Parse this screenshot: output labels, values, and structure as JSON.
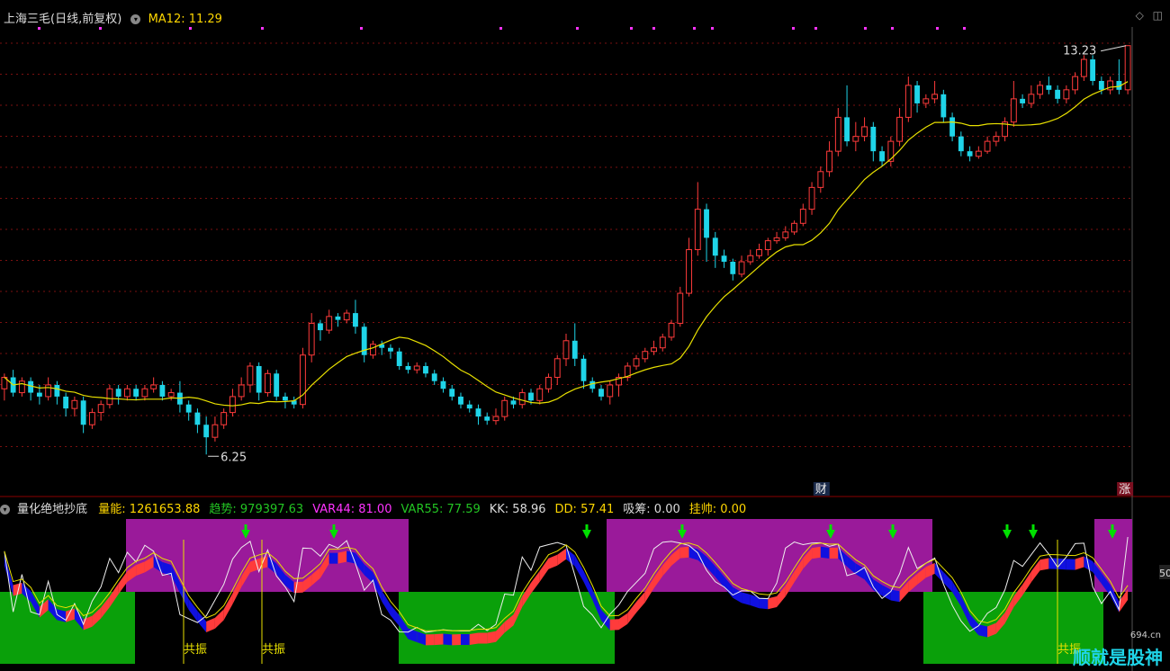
{
  "main_panel": {
    "title": "上海三毛(日线,前复权)",
    "ma_label": "MA12:",
    "ma_value": "11.29",
    "high_label": "13.23",
    "low_label": "6.25",
    "marker_cai": "财",
    "marker_zhang": "涨"
  },
  "indicator_panel": {
    "title": "量化绝地抄底",
    "items": [
      {
        "label": "量能:",
        "value": "1261653.88",
        "color": "#ffd700"
      },
      {
        "label": "趋势:",
        "value": "979397.63",
        "color": "#23c523"
      },
      {
        "label": "VAR44:",
        "value": "81.00",
        "color": "#ff33ff"
      },
      {
        "label": "VAR55:",
        "value": "77.59",
        "color": "#23c523"
      },
      {
        "label": "KK:",
        "value": "58.96",
        "color": "#dddddd"
      },
      {
        "label": "DD:",
        "value": "57.41",
        "color": "#ffd700"
      },
      {
        "label": "吸筹:",
        "value": "0.00",
        "color": "#dddddd"
      },
      {
        "label": "挂帅:",
        "value": "0.00",
        "color": "#ffd700"
      }
    ],
    "resonance_label": "共振",
    "right_edge_value": "50"
  },
  "watermark": {
    "text": "顺就是股神",
    "url": "694.cn"
  },
  "chart_data": {
    "type": "candlestick",
    "series_name": "上海三毛(日线,前复权)",
    "y_scale": "log",
    "candles": [
      [
        7.05,
        7.2,
        7.25,
        6.9
      ],
      [
        7.2,
        7.0,
        7.3,
        6.95
      ],
      [
        7.0,
        7.15,
        7.2,
        6.95
      ],
      [
        7.15,
        7.0,
        7.2,
        6.9
      ],
      [
        7.0,
        6.95,
        7.1,
        6.85
      ],
      [
        6.95,
        7.1,
        7.2,
        6.9
      ],
      [
        7.1,
        6.95,
        7.15,
        6.85
      ],
      [
        6.95,
        6.8,
        7.0,
        6.7
      ],
      [
        6.8,
        6.9,
        6.95,
        6.7
      ],
      [
        6.9,
        6.6,
        6.95,
        6.5
      ],
      [
        6.6,
        6.75,
        6.8,
        6.55
      ],
      [
        6.75,
        6.85,
        6.9,
        6.65
      ],
      [
        6.85,
        7.05,
        7.1,
        6.8
      ],
      [
        7.05,
        6.95,
        7.1,
        6.85
      ],
      [
        6.95,
        7.05,
        7.1,
        6.9
      ],
      [
        7.05,
        6.95,
        7.1,
        6.9
      ],
      [
        6.95,
        7.05,
        7.1,
        6.9
      ],
      [
        7.05,
        7.1,
        7.2,
        7.0
      ],
      [
        7.1,
        6.95,
        7.15,
        6.9
      ],
      [
        6.95,
        7.0,
        7.05,
        6.9
      ],
      [
        7.0,
        6.85,
        7.15,
        6.75
      ],
      [
        6.85,
        6.75,
        6.9,
        6.65
      ],
      [
        6.75,
        6.6,
        6.8,
        6.5
      ],
      [
        6.6,
        6.45,
        6.7,
        6.25
      ],
      [
        6.45,
        6.6,
        6.7,
        6.4
      ],
      [
        6.6,
        6.75,
        6.8,
        6.55
      ],
      [
        6.75,
        6.95,
        7.05,
        6.7
      ],
      [
        6.95,
        7.1,
        7.2,
        6.9
      ],
      [
        7.1,
        7.35,
        7.4,
        7.0
      ],
      [
        7.35,
        7.0,
        7.4,
        6.9
      ],
      [
        7.0,
        7.25,
        7.3,
        6.95
      ],
      [
        7.25,
        6.95,
        7.3,
        6.9
      ],
      [
        6.95,
        6.9,
        7.0,
        6.8
      ],
      [
        6.9,
        6.85,
        6.95,
        6.8
      ],
      [
        6.85,
        7.5,
        7.6,
        6.8
      ],
      [
        7.5,
        7.95,
        8.1,
        7.4
      ],
      [
        7.95,
        7.85,
        8.0,
        7.7
      ],
      [
        7.85,
        8.05,
        8.15,
        7.8
      ],
      [
        8.05,
        8.0,
        8.1,
        7.9
      ],
      [
        8.0,
        8.1,
        8.15,
        7.95
      ],
      [
        8.1,
        7.9,
        8.3,
        7.8
      ],
      [
        7.9,
        7.5,
        7.95,
        7.4
      ],
      [
        7.5,
        7.65,
        7.7,
        7.45
      ],
      [
        7.65,
        7.6,
        7.7,
        7.5
      ],
      [
        7.6,
        7.55,
        7.65,
        7.45
      ],
      [
        7.55,
        7.35,
        7.6,
        7.3
      ],
      [
        7.35,
        7.3,
        7.4,
        7.25
      ],
      [
        7.3,
        7.35,
        7.4,
        7.25
      ],
      [
        7.35,
        7.25,
        7.4,
        7.2
      ],
      [
        7.25,
        7.15,
        7.3,
        7.1
      ],
      [
        7.15,
        7.05,
        7.2,
        7.0
      ],
      [
        7.05,
        6.95,
        7.1,
        6.9
      ],
      [
        6.95,
        6.85,
        7.0,
        6.8
      ],
      [
        6.85,
        6.8,
        6.9,
        6.75
      ],
      [
        6.8,
        6.7,
        6.85,
        6.6
      ],
      [
        6.7,
        6.65,
        6.75,
        6.6
      ],
      [
        6.65,
        6.7,
        6.8,
        6.6
      ],
      [
        6.7,
        6.9,
        6.95,
        6.65
      ],
      [
        6.9,
        6.85,
        6.95,
        6.8
      ],
      [
        6.85,
        7.0,
        7.05,
        6.8
      ],
      [
        7.0,
        6.9,
        7.05,
        6.85
      ],
      [
        6.9,
        7.05,
        7.1,
        6.85
      ],
      [
        7.05,
        7.2,
        7.25,
        7.0
      ],
      [
        7.2,
        7.45,
        7.5,
        7.1
      ],
      [
        7.45,
        7.7,
        7.8,
        7.35
      ],
      [
        7.7,
        7.45,
        7.95,
        7.35
      ],
      [
        7.45,
        7.15,
        7.5,
        7.05
      ],
      [
        7.15,
        7.05,
        7.2,
        7.0
      ],
      [
        7.05,
        6.95,
        7.1,
        6.9
      ],
      [
        6.95,
        7.1,
        7.15,
        6.85
      ],
      [
        7.1,
        7.2,
        7.25,
        6.95
      ],
      [
        7.2,
        7.35,
        7.4,
        7.15
      ],
      [
        7.35,
        7.45,
        7.5,
        7.3
      ],
      [
        7.45,
        7.55,
        7.6,
        7.4
      ],
      [
        7.55,
        7.6,
        7.7,
        7.5
      ],
      [
        7.6,
        7.75,
        7.8,
        7.55
      ],
      [
        7.75,
        7.95,
        8.0,
        7.7
      ],
      [
        7.95,
        8.4,
        8.5,
        7.9
      ],
      [
        8.4,
        9.1,
        9.3,
        8.35
      ],
      [
        9.1,
        9.8,
        10.3,
        9.0
      ],
      [
        9.8,
        9.3,
        9.9,
        8.9
      ],
      [
        9.3,
        9.0,
        9.4,
        8.8
      ],
      [
        9.0,
        8.9,
        9.1,
        8.8
      ],
      [
        8.9,
        8.7,
        8.95,
        8.6
      ],
      [
        8.7,
        8.9,
        9.0,
        8.65
      ],
      [
        8.9,
        9.0,
        9.1,
        8.85
      ],
      [
        9.0,
        9.1,
        9.2,
        8.95
      ],
      [
        9.1,
        9.25,
        9.3,
        9.0
      ],
      [
        9.25,
        9.3,
        9.4,
        9.2
      ],
      [
        9.3,
        9.4,
        9.5,
        9.25
      ],
      [
        9.4,
        9.55,
        9.6,
        9.35
      ],
      [
        9.55,
        9.8,
        9.9,
        9.5
      ],
      [
        9.8,
        10.2,
        10.3,
        9.7
      ],
      [
        10.2,
        10.5,
        10.6,
        10.1
      ],
      [
        10.5,
        10.9,
        11.1,
        10.4
      ],
      [
        10.9,
        11.6,
        11.8,
        10.8
      ],
      [
        11.6,
        11.1,
        12.3,
        11.0
      ],
      [
        11.1,
        11.2,
        11.5,
        10.9
      ],
      [
        11.2,
        11.4,
        11.6,
        11.1
      ],
      [
        11.4,
        10.9,
        11.5,
        10.7
      ],
      [
        10.9,
        10.7,
        11.0,
        10.6
      ],
      [
        10.7,
        11.1,
        11.2,
        10.6
      ],
      [
        11.1,
        11.6,
        11.8,
        11.0
      ],
      [
        11.6,
        12.3,
        12.5,
        11.5
      ],
      [
        12.3,
        11.9,
        12.4,
        11.7
      ],
      [
        11.9,
        12.0,
        12.1,
        11.8
      ],
      [
        12.0,
        12.1,
        12.4,
        11.9
      ],
      [
        12.1,
        11.6,
        12.2,
        11.5
      ],
      [
        11.6,
        11.2,
        11.7,
        11.1
      ],
      [
        11.2,
        10.9,
        11.3,
        10.8
      ],
      [
        10.9,
        10.8,
        11.0,
        10.7
      ],
      [
        10.8,
        10.9,
        11.0,
        10.75
      ],
      [
        10.9,
        11.1,
        11.2,
        10.85
      ],
      [
        11.1,
        11.2,
        11.3,
        11.0
      ],
      [
        11.2,
        11.5,
        11.6,
        11.1
      ],
      [
        11.5,
        12.0,
        12.4,
        11.4
      ],
      [
        12.0,
        11.9,
        12.1,
        11.8
      ],
      [
        11.9,
        12.1,
        12.3,
        11.8
      ],
      [
        12.1,
        12.3,
        12.4,
        12.0
      ],
      [
        12.3,
        12.2,
        12.5,
        12.1
      ],
      [
        12.2,
        12.0,
        12.3,
        11.9
      ],
      [
        12.0,
        12.2,
        12.3,
        11.9
      ],
      [
        12.2,
        12.5,
        12.6,
        12.1
      ],
      [
        12.5,
        12.9,
        13.0,
        12.4
      ],
      [
        12.9,
        12.4,
        13.0,
        12.3
      ],
      [
        12.4,
        12.2,
        12.5,
        12.1
      ],
      [
        12.2,
        12.4,
        12.5,
        12.1
      ],
      [
        12.4,
        12.2,
        12.9,
        12.1
      ],
      [
        12.2,
        13.23,
        13.23,
        12.1
      ]
    ],
    "ma12_label": "MA12",
    "ma12_last": 11.29,
    "indicator": {
      "name": "量化绝地抄底",
      "kk_last": 58.96,
      "dd_last": 57.41,
      "var44_last": 81.0,
      "var55_last": 77.59
    }
  }
}
